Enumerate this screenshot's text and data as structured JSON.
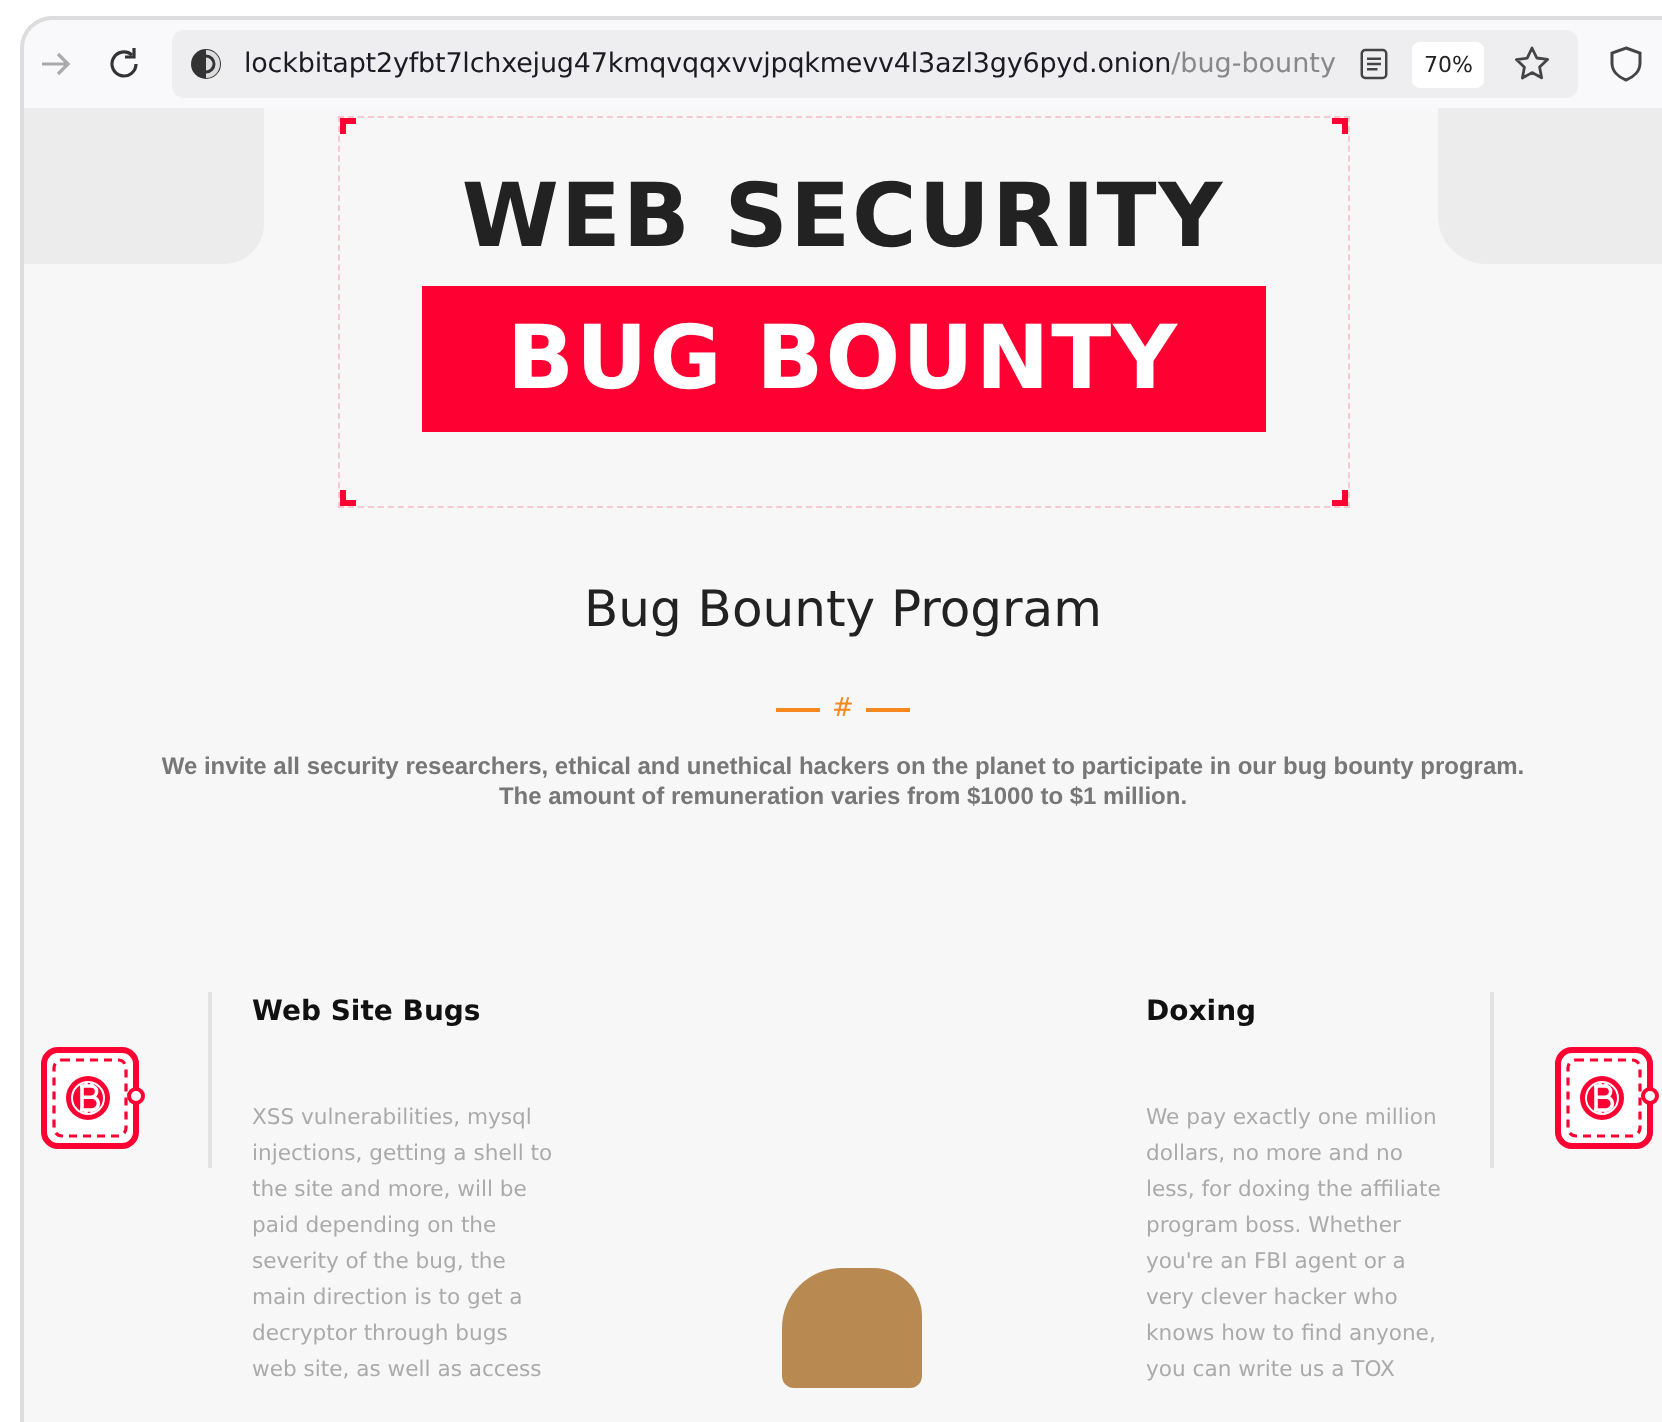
{
  "toolbar": {
    "url_host": "lockbitapt2yfbt7lchxejug47kmqvqqxvvjpqkmevv4l3azl3gy6pyd.onion",
    "url_path": "/bug-bounty",
    "zoom": "70%"
  },
  "hero": {
    "line_1": "WEB SECURITY",
    "line_2": "BUG BOUNTY"
  },
  "section": {
    "title": "Bug Bounty Program",
    "divider": "#",
    "intro": [
      "We invite all security researchers, ethical and unethical hackers on the planet to participate in our bug bounty program.",
      "The amount of remuneration varies from $1000 to $1 million."
    ]
  },
  "cards": [
    {
      "title": "Web Site Bugs",
      "text": "XSS vulnerabilities, mysql injections, getting a shell to the site and more, will be paid depending on the severity of the bug, the main direction is to get a decryptor through bugs web site, as well as access"
    },
    {
      "title": "Doxing",
      "text": "We pay exactly one million dollars, no more and no less, for doxing the affiliate program boss. Whether you're an FBI agent or a very clever hacker who knows how to find anyone, you can write us a TOX"
    }
  ]
}
